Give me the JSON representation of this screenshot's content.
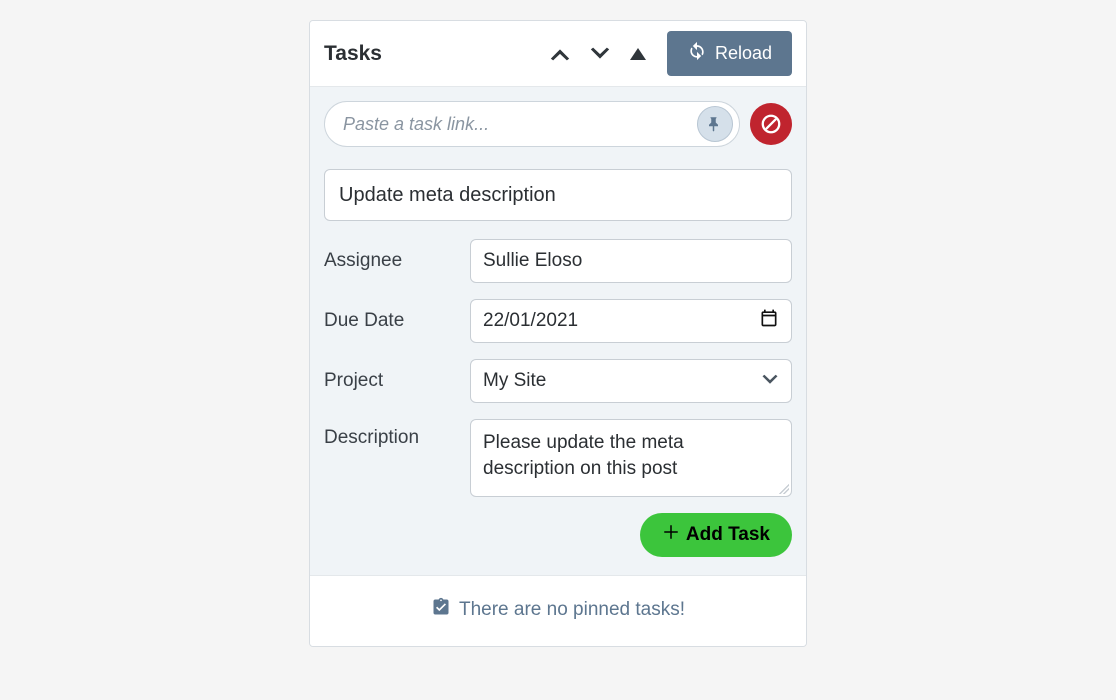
{
  "header": {
    "title": "Tasks",
    "reload_label": "Reload"
  },
  "link_row": {
    "placeholder": "Paste a task link..."
  },
  "form": {
    "title_value": "Update meta description",
    "assignee": {
      "label": "Assignee",
      "value": "Sullie Eloso"
    },
    "due_date": {
      "label": "Due Date",
      "value": "22/01/2021"
    },
    "project": {
      "label": "Project",
      "value": "My Site"
    },
    "description": {
      "label": "Description",
      "value": "Please update the meta description on this post"
    }
  },
  "actions": {
    "add_task_label": "Add Task"
  },
  "footer": {
    "empty_text": "There are no pinned tasks!"
  }
}
